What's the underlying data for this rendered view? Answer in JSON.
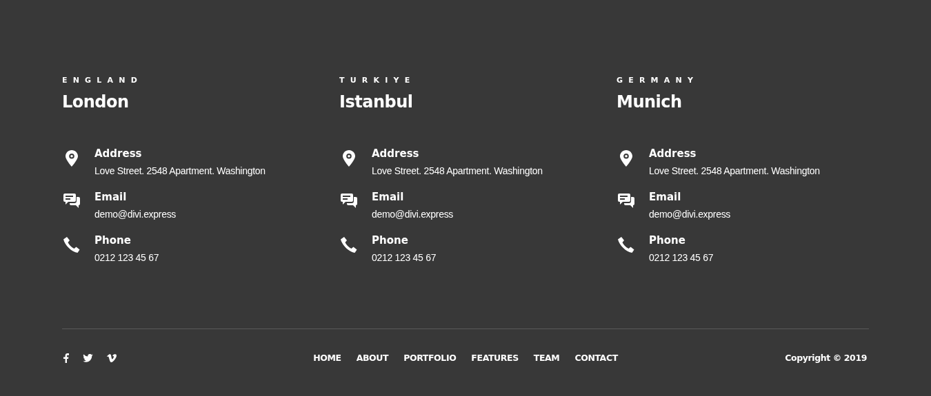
{
  "offices": [
    {
      "country": "ENGLAND",
      "city": "London",
      "contacts": [
        {
          "kind": "address",
          "label": "Address",
          "value": "Love Street. 2548 Apartment. Washington"
        },
        {
          "kind": "email",
          "label": "Email",
          "value": "demo@divi.express"
        },
        {
          "kind": "phone",
          "label": "Phone",
          "value": "0212 123 45 67"
        }
      ]
    },
    {
      "country": "TURKIYE",
      "city": "Istanbul",
      "contacts": [
        {
          "kind": "address",
          "label": "Address",
          "value": "Love Street. 2548 Apartment. Washington"
        },
        {
          "kind": "email",
          "label": "Email",
          "value": "demo@divi.express"
        },
        {
          "kind": "phone",
          "label": "Phone",
          "value": "0212 123 45 67"
        }
      ]
    },
    {
      "country": "GERMANY",
      "city": "Munich",
      "contacts": [
        {
          "kind": "address",
          "label": "Address",
          "value": "Love Street. 2548 Apartment. Washington"
        },
        {
          "kind": "email",
          "label": "Email",
          "value": "demo@divi.express"
        },
        {
          "kind": "phone",
          "label": "Phone",
          "value": "0212 123 45 67"
        }
      ]
    }
  ],
  "footer": {
    "social": [
      {
        "kind": "facebook"
      },
      {
        "kind": "twitter"
      },
      {
        "kind": "vimeo"
      }
    ],
    "nav": [
      "HOME",
      "ABOUT",
      "PORTFOLIO",
      "FEATURES",
      "TEAM",
      "CONTACT"
    ],
    "copyright": "Copyright © 2019"
  }
}
